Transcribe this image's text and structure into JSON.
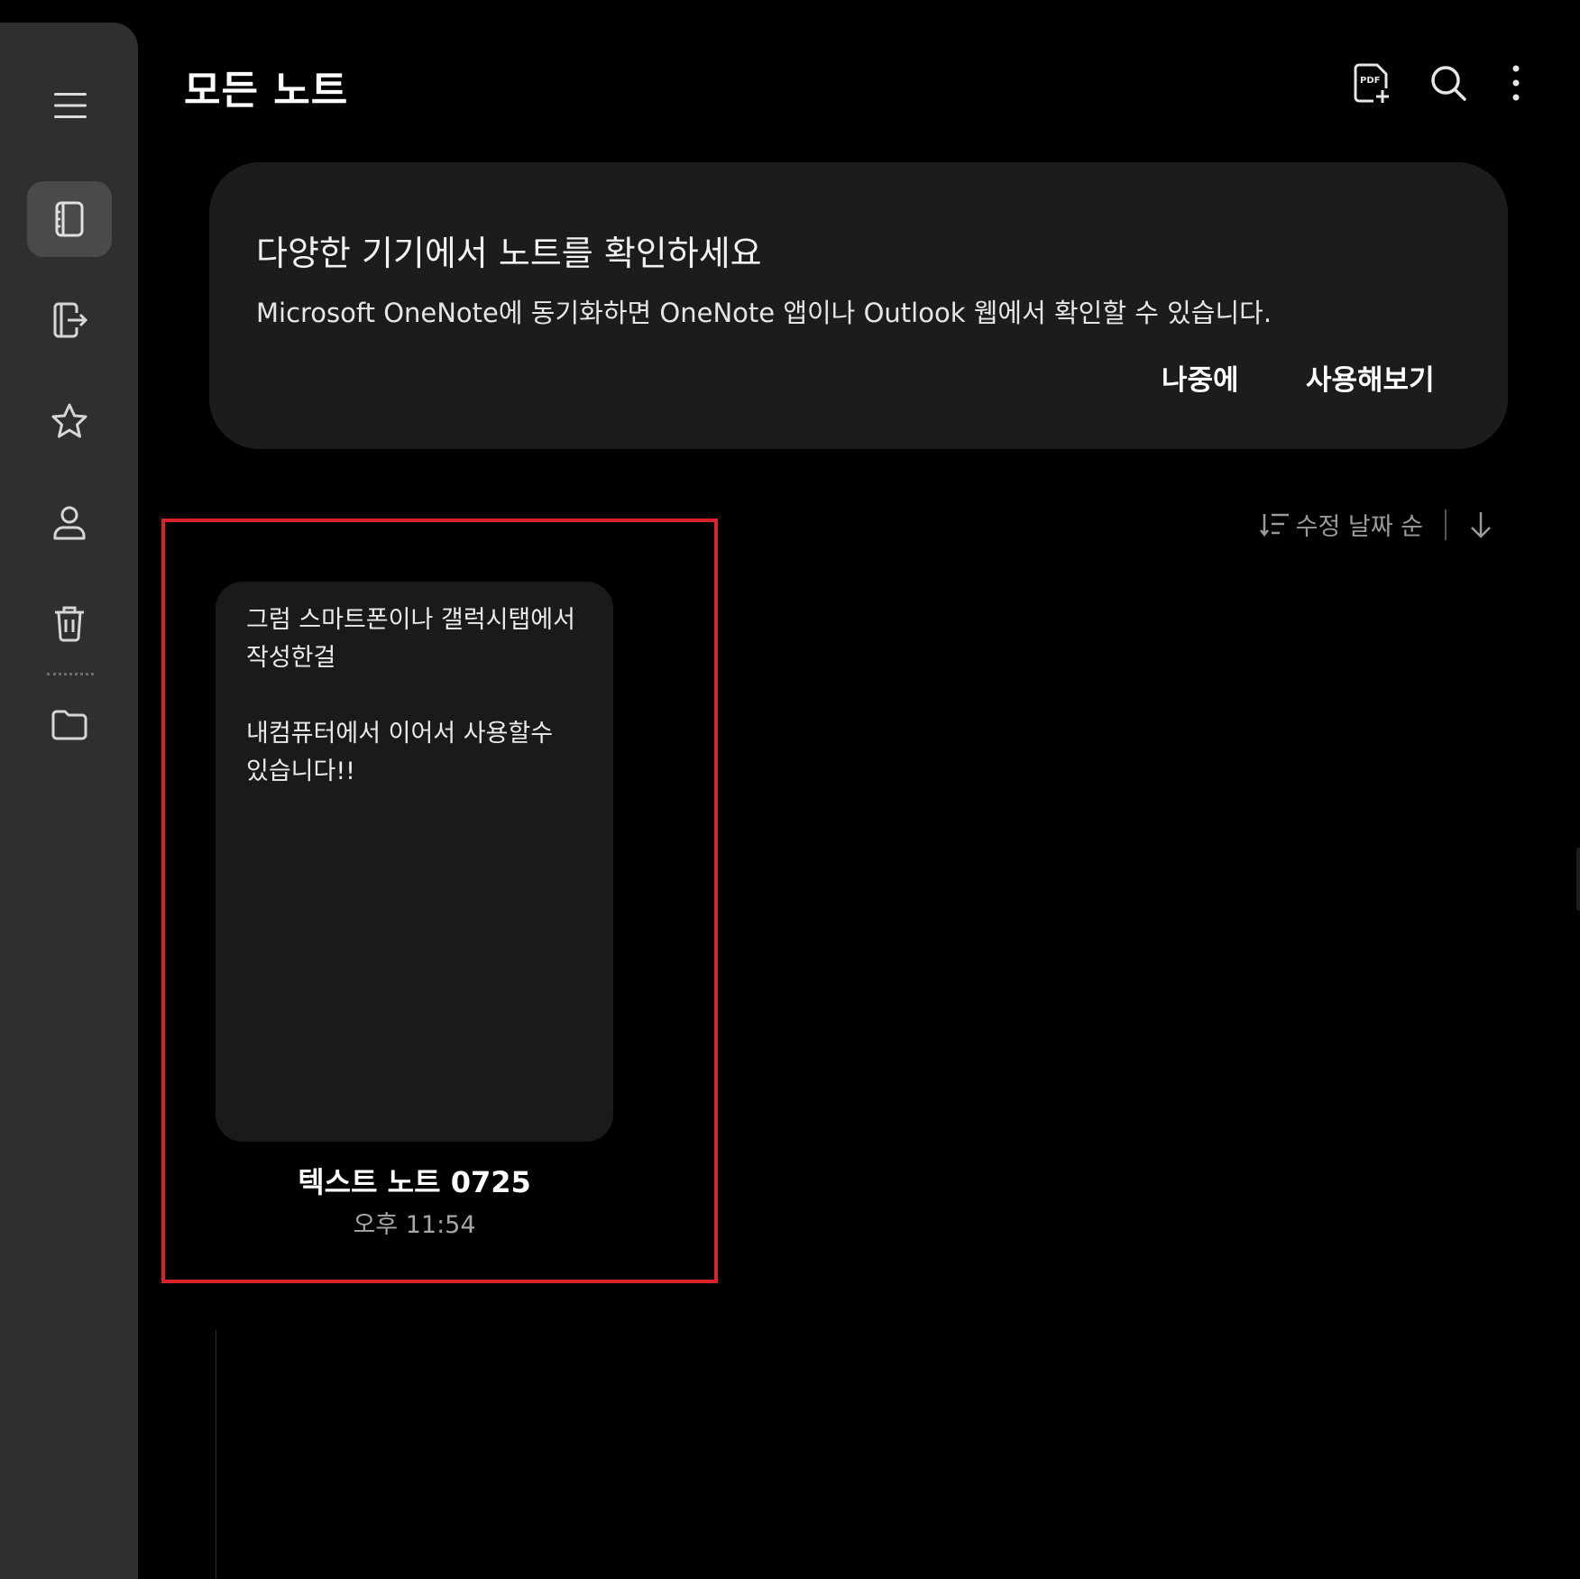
{
  "header": {
    "title": "모든 노트"
  },
  "icons": {
    "menu": "hamburger-menu-icon",
    "notes": "notebook-icon",
    "shared": "export-note-icon",
    "favorites": "star-icon",
    "account": "person-icon",
    "trash": "trash-icon",
    "folder": "folder-icon",
    "pdf_import": "pdf-add-icon",
    "search": "search-icon",
    "more": "more-vertical-icon",
    "sort": "sort-lines-icon",
    "sort_direction": "arrow-down-icon"
  },
  "banner": {
    "title": "다양한 기기에서 노트를 확인하세요",
    "description": "Microsoft OneNote에 동기화하면 OneNote 앱이나 Outlook 웹에서 확인할 수 있습니다.",
    "later_label": "나중에",
    "try_label": "사용해보기"
  },
  "sort": {
    "label": "수정 날짜 순"
  },
  "notes": [
    {
      "preview_lines": [
        "그럼 스마트폰이나 갤럭시탭에서",
        "작성한걸",
        "",
        "내컴퓨터에서 이어서 사용할수",
        "있습니다!!"
      ],
      "title": "텍스트 노트 0725",
      "time": "오후 11:54"
    }
  ],
  "colors": {
    "background": "#000000",
    "sidebar": "#2f2f2f",
    "card": "#1a1a1a",
    "banner": "#1c1c1c",
    "highlight": "#d8232a"
  }
}
